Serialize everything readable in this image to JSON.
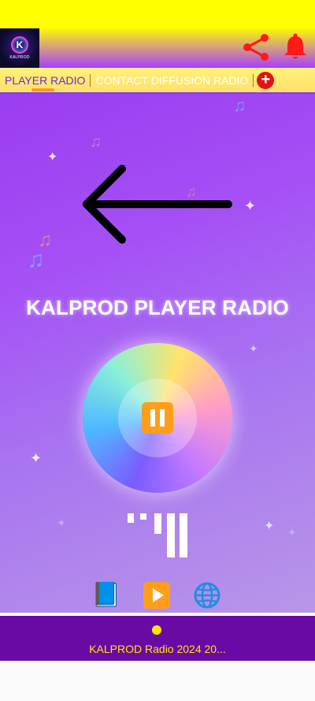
{
  "header": {
    "logo_text": "KALPROD",
    "share_icon": "share-icon",
    "bell_icon": "bell-icon",
    "accent_color": "#ff1a1a"
  },
  "tabs": [
    {
      "label": "PLAYER RADIO",
      "active": true
    },
    {
      "label": "CONTACT DIFFUSION RADIO",
      "active": false
    }
  ],
  "add_tab_icon": "plus-icon",
  "player": {
    "title": "KALPROD PLAYER RADIO",
    "state": "playing",
    "control_icon": "pause-icon"
  },
  "bottom_icons": [
    "book-icon",
    "play-icon",
    "globe-icon"
  ],
  "now_playing": {
    "text": "KALPROD Radio 2024 20..."
  },
  "colors": {
    "header_top": "#ffff00",
    "background_purple": "#9a3df0",
    "now_playing_bg": "#6a0aa5",
    "now_playing_text": "#ffe600",
    "tab_indicator": "#ff9b18"
  }
}
